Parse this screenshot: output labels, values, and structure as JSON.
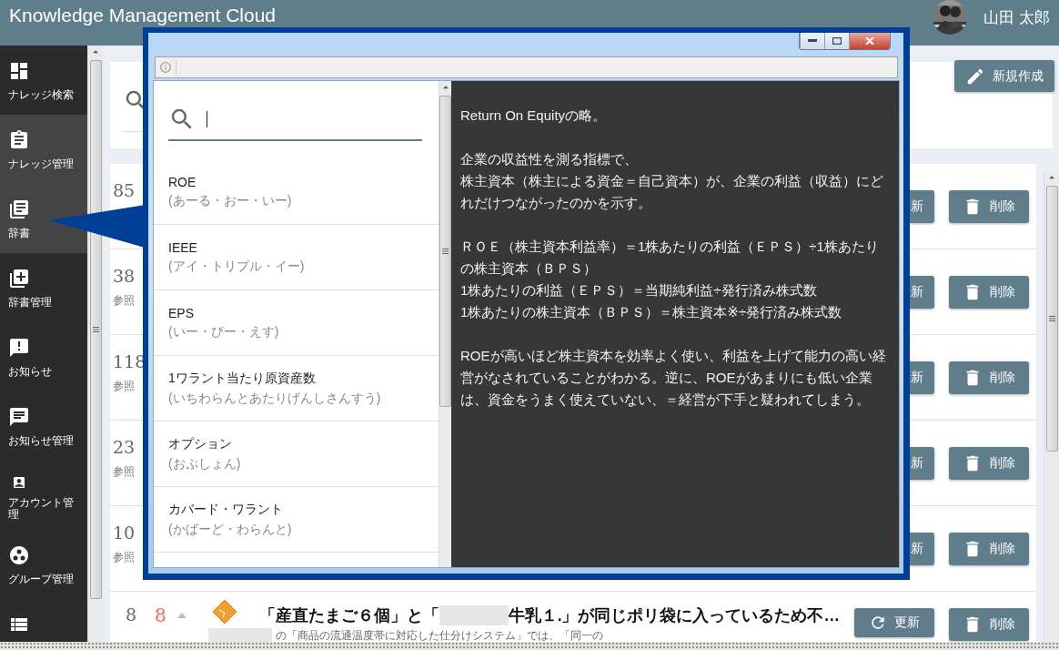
{
  "header": {
    "title": "Knowledge Management Cloud",
    "user_name": "山田 太郎"
  },
  "sidebar": {
    "items": [
      {
        "kind": "dashboard",
        "label": "ナレッジ検索",
        "selected": false
      },
      {
        "kind": "clipboard",
        "label": "ナレッジ管理",
        "selected": true
      },
      {
        "kind": "books",
        "label": "辞書",
        "selected": true
      },
      {
        "kind": "book-add",
        "label": "辞書管理",
        "selected": false
      },
      {
        "kind": "alert",
        "label": "お知らせ",
        "selected": false
      },
      {
        "kind": "chat",
        "label": "お知らせ管理",
        "selected": false
      },
      {
        "kind": "account",
        "label": "アカウント管理",
        "selected": false
      },
      {
        "kind": "group",
        "label": "グループ管理",
        "selected": false
      },
      {
        "kind": "list",
        "selected": false
      }
    ]
  },
  "toolbar": {
    "new_button": "新規作成"
  },
  "rows": [
    {
      "kind": "covered",
      "count": "85",
      "update_label": "新",
      "delete_label": "削除"
    },
    {
      "kind": "covered",
      "count": "38",
      "ref_label": "参照",
      "update_label": "新",
      "delete_label": "削除"
    },
    {
      "kind": "covered",
      "count": "118",
      "ref_label": "参照",
      "update_label": "新",
      "delete_label": "削除"
    },
    {
      "kind": "covered",
      "count": "23",
      "ref_label": "参照",
      "update_label": "新",
      "delete_label": "削除"
    },
    {
      "kind": "covered",
      "count": "10",
      "ref_label": "参照",
      "update_label": "新",
      "delete_label": "削除"
    },
    {
      "kind": "full",
      "count": "8",
      "votes": "8",
      "title_before": "「産直たまご６個」と「",
      "title_after": "牛乳１.」が同じポリ袋に入っているため不…",
      "summary": "の「商品の流通温度帯に対応した仕分けシステム」では、「同一の",
      "update_label": "更新",
      "delete_label": "削除"
    }
  ],
  "dialog": {
    "terms": [
      {
        "term": "ROE",
        "reading": "(あーる・おー・いー)"
      },
      {
        "term": "IEEE",
        "reading": "(アイ・トリプル・イー)"
      },
      {
        "term": "EPS",
        "reading": "(いー・ぴー・えす)"
      },
      {
        "term": "1ワラント当たり原資産数",
        "reading": "(いちわらんとあたりげんしさんすう)"
      },
      {
        "term": "オプション",
        "reading": "(おぷしょん)"
      },
      {
        "term": "カバード・ワラント",
        "reading": "(かばーど・わらんと)"
      }
    ],
    "description": [
      [
        "Return On Equityの略。"
      ],
      [
        "企業の収益性を測る指標で、",
        "株主資本（株主による資金＝自己資本）が、企業の利益（収益）にどれだけつながったのかを示す。"
      ],
      [
        "ＲＯＥ（株主資本利益率）＝1株あたりの利益（ＥＰＳ）÷1株あたりの株主資本（ＢＰＳ）",
        "1株あたりの利益（ＥＰＳ）＝当期純利益÷発行済み株式数",
        "1株あたりの株主資本（ＢＰＳ）＝株主資本※÷発行済み株式数"
      ],
      [
        "ROEが高いほど株主資本を効率よく使い、利益を上げて能力の高い経営がなされていることがわかる。逆に、ROEがあまりにも低い企業は、資金をうまく使えていない、＝経営が下手と疑われてしまう。"
      ]
    ]
  }
}
